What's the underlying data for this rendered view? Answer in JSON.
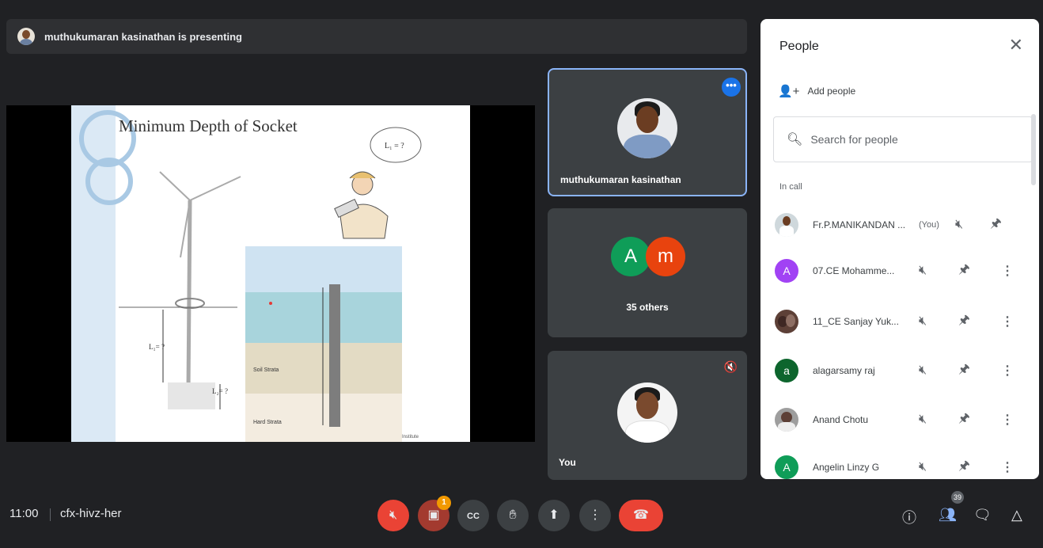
{
  "presenter_banner": {
    "text": "muthukumaran kasinathan is presenting"
  },
  "slide": {
    "title": "Minimum Depth of Socket",
    "labels": {
      "bubble": "L₁ = ?",
      "left_length": "L₁= ?",
      "bottom_length": "L₂= ?",
      "soil": "Soil Strata",
      "rock": "Hard Strata",
      "footer": "Institute"
    }
  },
  "tiles": [
    {
      "name": "muthukumaran kasinathan",
      "more_icon": "more-horiz-icon"
    },
    {
      "letters": [
        "A",
        "m"
      ],
      "label": "35 others",
      "colors": [
        "#0f9d58",
        "#e8430e"
      ]
    },
    {
      "name": "You",
      "icon": "mic-off-icon"
    }
  ],
  "people_panel": {
    "title": "People",
    "add_people": "Add people",
    "search_placeholder": "Search for people",
    "section": "In call",
    "participants": [
      {
        "name": "Fr.P.MANIKANDAN ...",
        "tag": "(You)",
        "avatar": "photo",
        "color": "#cfd8dc"
      },
      {
        "name": "07.CE Mohamme...",
        "avatar": "A",
        "color": "#a142f4"
      },
      {
        "name": "11_CE Sanjay Yuk...",
        "avatar": "photo",
        "color": "#5d4037"
      },
      {
        "name": "alagarsamy raj",
        "avatar": "a",
        "color": "#0d652d"
      },
      {
        "name": "Anand Chotu",
        "avatar": "photo",
        "color": "#9e9e9e"
      },
      {
        "name": "Angelin Linzy G",
        "avatar": "A",
        "color": "#0f9d58"
      }
    ]
  },
  "bottom_bar": {
    "time": "11:00",
    "meeting_code": "cfx-hivz-her",
    "activity_badge": "1",
    "people_count": "39"
  },
  "colors": {
    "accent": "#8ab4f8",
    "danger": "#ea4335",
    "bg": "#202124"
  }
}
